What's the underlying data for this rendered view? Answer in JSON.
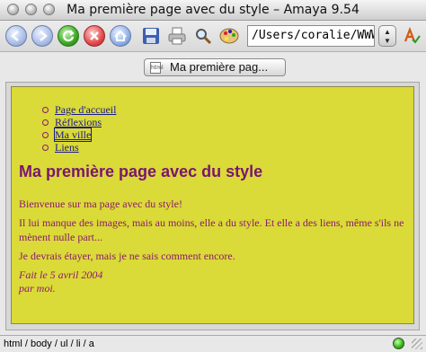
{
  "window": {
    "title": "Ma première page avec du style – Amaya 9.54"
  },
  "toolbar": {
    "url_value": "/Users/coralie/WWW/",
    "stepper_arrows": "▲▼",
    "icons": [
      "back-icon",
      "forward-icon",
      "reload-icon",
      "stop-icon",
      "home-icon",
      "save-icon",
      "print-icon",
      "find-icon",
      "palette-icon",
      "spell-check-icon"
    ]
  },
  "tab": {
    "label": "Ma première pag...",
    "icon_text": "html"
  },
  "document": {
    "nav_links": [
      "Page d'accueil",
      "Réflexions",
      "Ma ville",
      "Liens"
    ],
    "heading": "Ma première page avec du style",
    "para1": "Bienvenue sur ma page avec du style!",
    "para2": "Il lui manque des images, mais au moins, elle a du style. Et elle a des liens, même s'ils ne mènent nulle part...",
    "para3": "Je devrais étayer, mais je ne sais comment encore.",
    "sig1": "Fait le 5 avril 2004",
    "sig2": "par moi."
  },
  "status": {
    "path": "html / body / ul / li / a"
  },
  "colors": {
    "doc_background": "#dada38",
    "text": "#8b1a6f",
    "link": "#1a1a8f",
    "status_led": "#3dbb1e"
  }
}
